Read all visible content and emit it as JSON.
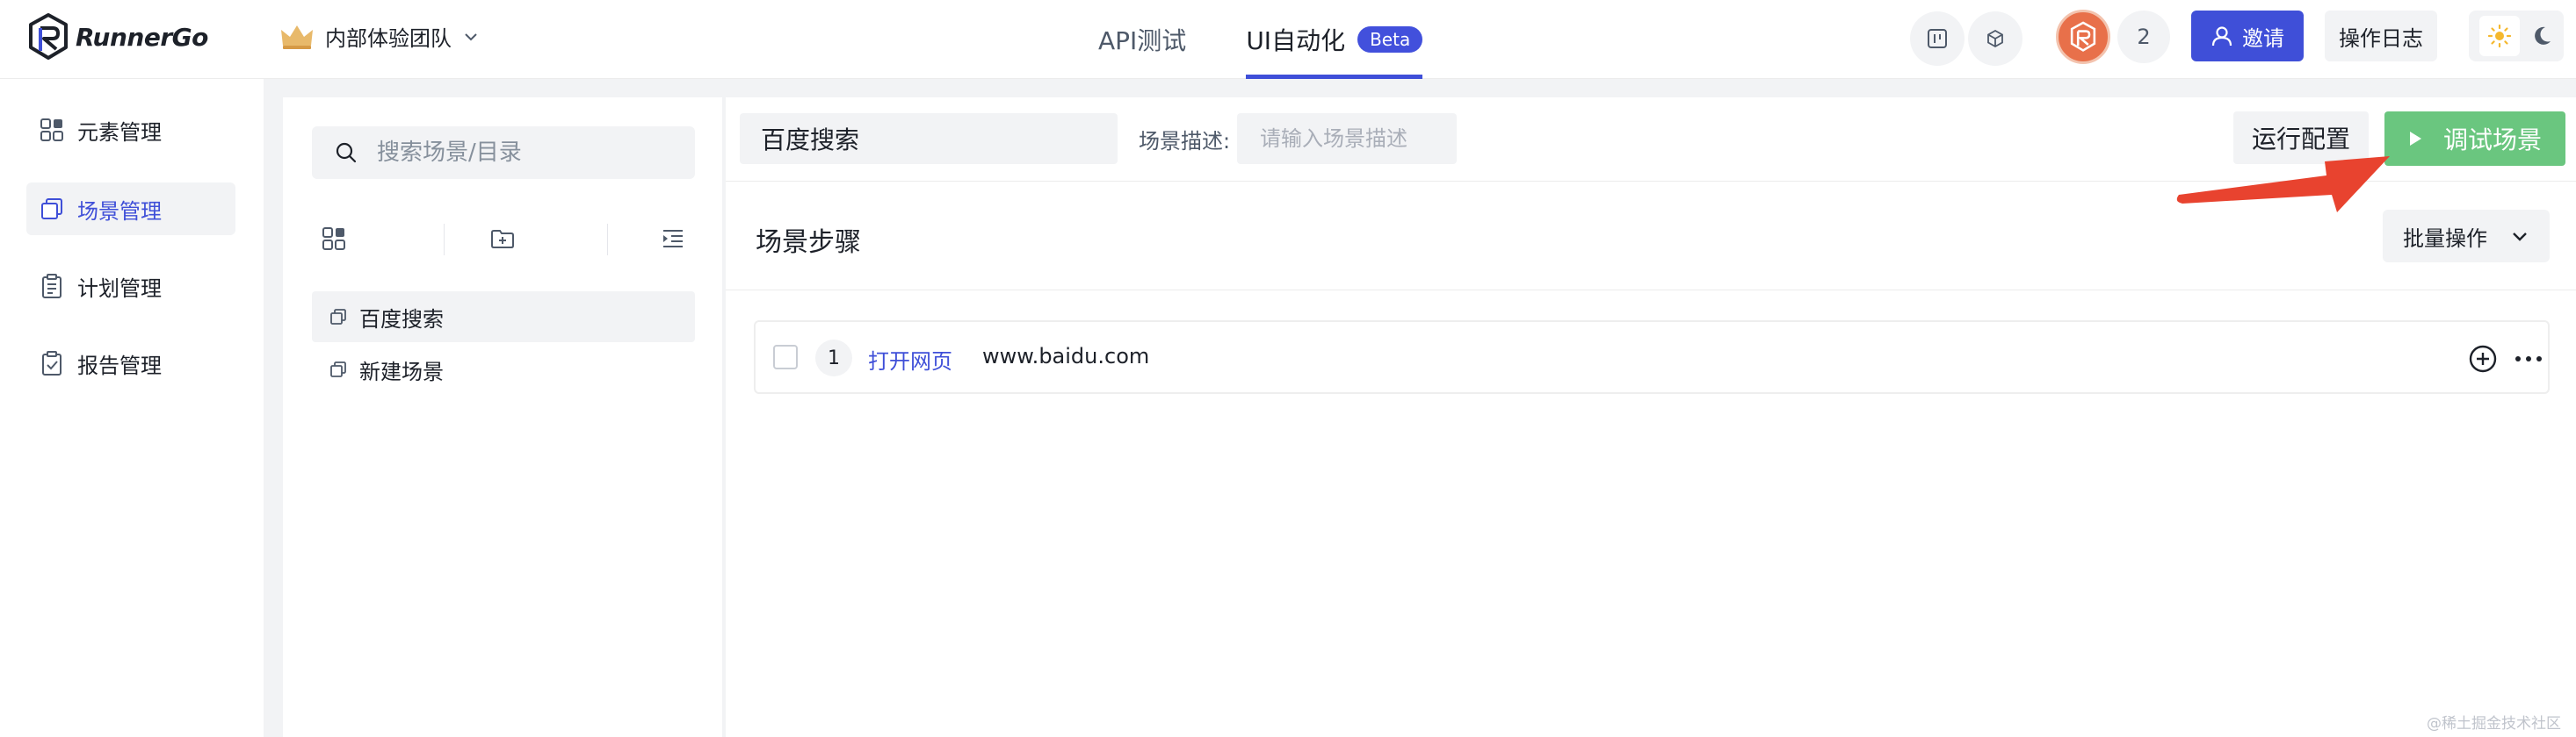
{
  "header": {
    "brand": "RunnerGo",
    "team": "内部体验团队",
    "tabs": [
      {
        "label": "API测试",
        "active": false
      },
      {
        "label": "UI自动化",
        "active": true,
        "badge": "Beta"
      }
    ],
    "member_count": "2",
    "invite_label": "邀请",
    "log_label": "操作日志"
  },
  "sidebar": {
    "items": [
      {
        "label": "元素管理",
        "icon": "grid-icon"
      },
      {
        "label": "场景管理",
        "icon": "copy-icon",
        "active": true
      },
      {
        "label": "计划管理",
        "icon": "clipboard-list-icon"
      },
      {
        "label": "报告管理",
        "icon": "clipboard-check-icon"
      }
    ]
  },
  "tree": {
    "search_placeholder": "搜索场景/目录",
    "items": [
      {
        "label": "百度搜索",
        "selected": true
      },
      {
        "label": "新建场景",
        "selected": false
      }
    ]
  },
  "main": {
    "scene_name": "百度搜索",
    "desc_label": "场景描述:",
    "desc_placeholder": "请输入场景描述",
    "run_config_label": "运行配置",
    "debug_label": "调试场景",
    "steps_title": "场景步骤",
    "batch_label": "批量操作",
    "steps": [
      {
        "index": "1",
        "type": "打开网页",
        "value": "www.baidu.com"
      }
    ]
  },
  "watermark": "@稀土掘金技术社区",
  "colors": {
    "accent": "#3f4fd8",
    "success": "#6ac67f",
    "annotation_arrow": "#e8432f",
    "avatar": "#e8704a"
  }
}
